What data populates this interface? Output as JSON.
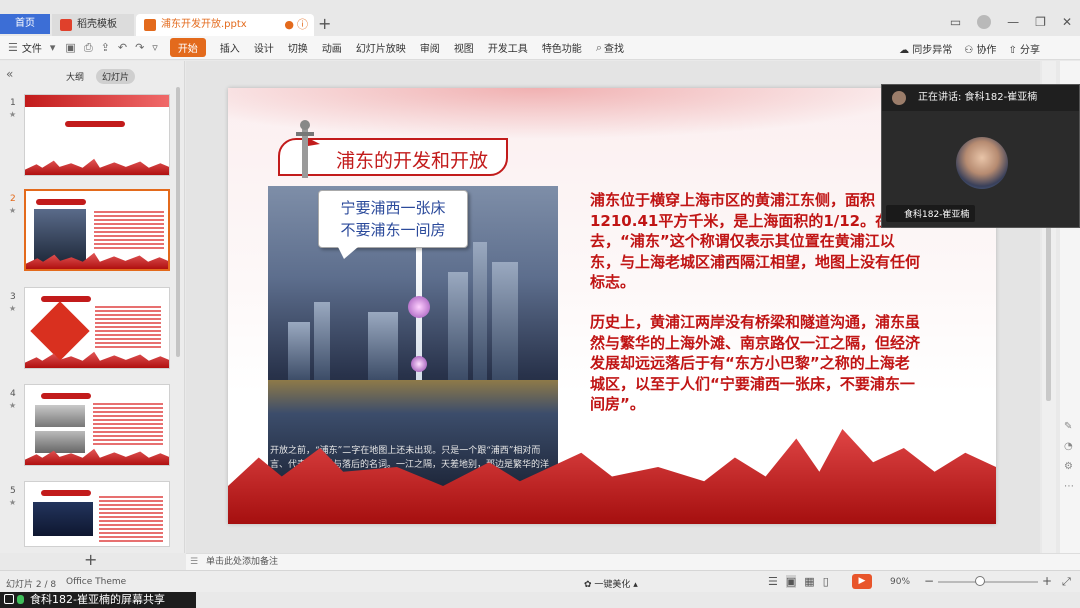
{
  "tabs": {
    "home": "首页",
    "template": "稻壳模板",
    "document": "浦东开发开放.pptx"
  },
  "toolbar": {
    "file": "文件",
    "start": "开始",
    "insert": "插入",
    "design": "设计",
    "transition": "切换",
    "animation": "动画",
    "slideshow": "幻灯片放映",
    "review": "审阅",
    "view": "视图",
    "developer": "开发工具",
    "features": "特色功能",
    "search": "查找",
    "sync": "同步异常",
    "collab": "协作",
    "share": "分享"
  },
  "left_panel": {
    "tab_outline": "大纲",
    "tab_slides": "幻灯片",
    "thumbnails": [
      {
        "num": "1"
      },
      {
        "num": "2"
      },
      {
        "num": "3"
      },
      {
        "num": "4"
      },
      {
        "num": "5"
      }
    ]
  },
  "slide": {
    "title": "浦东的开发和开放",
    "bubble_line1": "宁要浦西一张床",
    "bubble_line2": "不要浦东一间房",
    "caption": "开放之前，“浦东”二字在地图上还未出现。只是一个跟“浦西”相对而言、代表着东岸与落后的名词。一江之隔，天差地别，那边是繁华的洋场，这边是荒僻的农田。",
    "paragraph1": "浦东位于横穿上海市区的黄浦江东侧，面积1210.41平方千米，是上海面积的1/12。在过去，“浦东”这个称谓仅表示其位置在黄浦江以东，与上海老城区浦西隔江相望，地图上没有任何标志。",
    "paragraph2": "历史上，黄浦江两岸没有桥梁和隧道沟通，浦东虽然与繁华的上海外滩、南京路仅一江之隔，但经济发展却远远落后于有“东方小巴黎”之称的上海老城区，以至于人们“宁要浦西一张床，不要浦东一间房”。"
  },
  "call": {
    "speaking": "正在讲话: 食科182-崔亚楠",
    "name": "食科182-崔亚楠"
  },
  "notes": {
    "placeholder": "单击此处添加备注"
  },
  "status": {
    "slide_pos": "幻灯片 2 / 8",
    "theme": "Office Theme",
    "beautify": "一键美化",
    "zoom": "90%"
  },
  "share": {
    "label": "食科182-崔亚楠的屏幕共享"
  },
  "colors": {
    "accent": "#e36a1c",
    "slide_red": "#c01414",
    "bubble_text": "#2b4a9b"
  }
}
